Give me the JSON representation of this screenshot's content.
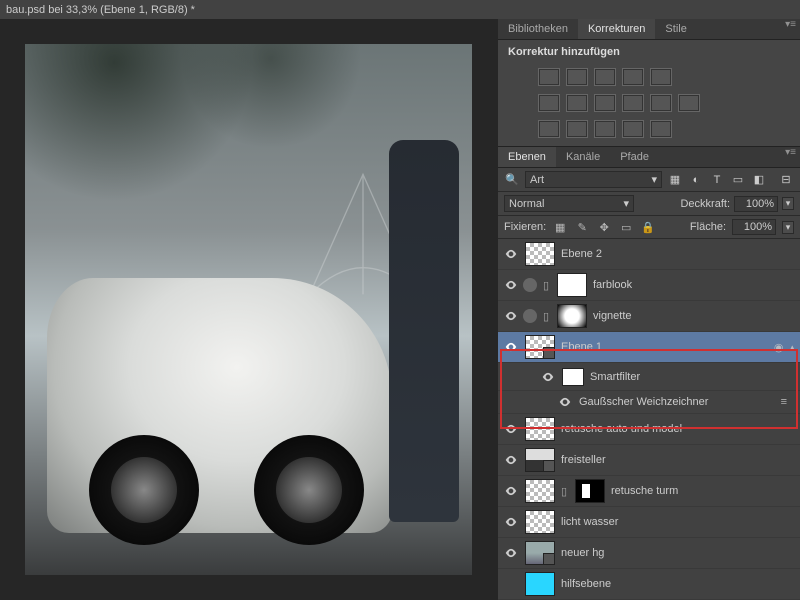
{
  "titlebar": "bau.psd bei 33,3% (Ebene 1, RGB/8) *",
  "top_tabs": {
    "biblio": "Bibliotheken",
    "korr": "Korrekturen",
    "stile": "Stile"
  },
  "korrekturen": {
    "add": "Korrektur hinzufügen"
  },
  "layer_tabs": {
    "eben": "Ebenen",
    "kan": "Kanäle",
    "pf": "Pfade"
  },
  "layerbar": {
    "searchType": "Art",
    "blendMode": "Normal",
    "opacityLabel": "Deckkraft:",
    "opacity": "100%",
    "fillLabel": "Fläche:",
    "fill": "100%",
    "lockLabel": "Fixieren:"
  },
  "layers": {
    "l0": "Ebene 2",
    "l1": "farblook",
    "l2": "vignette",
    "l3": "Ebene 1",
    "sf": "Smartfilter",
    "gb": "Gaußscher Weichzeichner",
    "l4": "retusche auto und model",
    "l5": "freisteller",
    "l6": "retusche turm",
    "l7": "licht wasser",
    "l8": "neuer hg",
    "l9": "hilfsebene"
  },
  "glyph": {
    "adjust": "⟳",
    "down": "▾",
    "eq": "≡"
  }
}
